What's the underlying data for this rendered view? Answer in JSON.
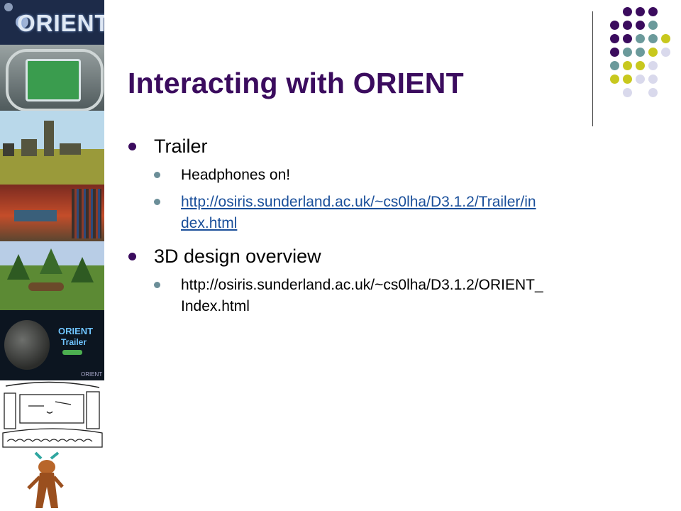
{
  "slide": {
    "title": "Interacting with ORIENT",
    "bullets": [
      {
        "text": "Trailer",
        "sub": [
          {
            "text": "Headphones on!"
          },
          {
            "text": "http://osiris.sunderland.ac.uk/~cs0lha/D3.1.2/Trailer/in dex.html",
            "line1": "http://osiris.sunderland.ac.uk/~cs0lha/D3.1.2/Trailer/in",
            "line2": "dex.html"
          }
        ]
      },
      {
        "text": "3D design overview",
        "sub": [
          {
            "text": "http://osiris.sunderland.ac.uk/~cs0lha/D3.1.2/ORIENT_ Index.html",
            "line1": "http://osiris.sunderland.ac.uk/~cs0lha/D3.1.2/ORIENT_",
            "line2": "Index.html"
          }
        ]
      }
    ]
  },
  "side_images": {
    "logo_text": "ORIENT",
    "trailer_title": "ORIENT",
    "trailer_subtitle": "Trailer",
    "trailer_badge": "ORIENT"
  },
  "colors": {
    "title": "#3b0c5e",
    "purple": "#3b0c5e",
    "teal": "#6b9a9b",
    "olive": "#c8c81e",
    "lavender": "#d9d9ec"
  }
}
